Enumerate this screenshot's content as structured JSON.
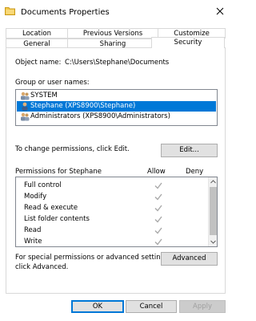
{
  "window": {
    "title": "Documents Properties"
  },
  "tabs": {
    "top_row": [
      "Location",
      "Previous Versions",
      "Customize"
    ],
    "bottom_row": [
      "General",
      "Sharing",
      "Security"
    ],
    "active": "Security"
  },
  "security": {
    "object_name_label": "Object name:",
    "object_name_value": "C:\\Users\\Stephane\\Documents",
    "groups_label": "Group or user names:",
    "groups": [
      {
        "name": "SYSTEM",
        "selected": false
      },
      {
        "name": "Stephane (XPS8900\\Stephane)",
        "selected": true
      },
      {
        "name": "Administrators (XPS8900\\Administrators)",
        "selected": false
      }
    ],
    "change_text": "To change permissions, click Edit.",
    "edit_label": "Edit...",
    "permissions_for_label": "Permissions for Stephane",
    "allow_header": "Allow",
    "deny_header": "Deny",
    "permissions": [
      {
        "name": "Full control",
        "allow": true,
        "deny": false
      },
      {
        "name": "Modify",
        "allow": true,
        "deny": false
      },
      {
        "name": "Read & execute",
        "allow": true,
        "deny": false
      },
      {
        "name": "List folder contents",
        "allow": true,
        "deny": false
      },
      {
        "name": "Read",
        "allow": true,
        "deny": false
      },
      {
        "name": "Write",
        "allow": true,
        "deny": false
      }
    ],
    "special_line1": "For special permissions or advanced settings,",
    "special_line2": "click Advanced.",
    "advanced_label": "Advanced"
  },
  "footer": {
    "ok_label": "OK",
    "cancel_label": "Cancel",
    "apply_label": "Apply"
  },
  "colors": {
    "selection": "#0078d7",
    "check_gray": "#a8a8a8",
    "button_face": "#e1e1e1"
  }
}
